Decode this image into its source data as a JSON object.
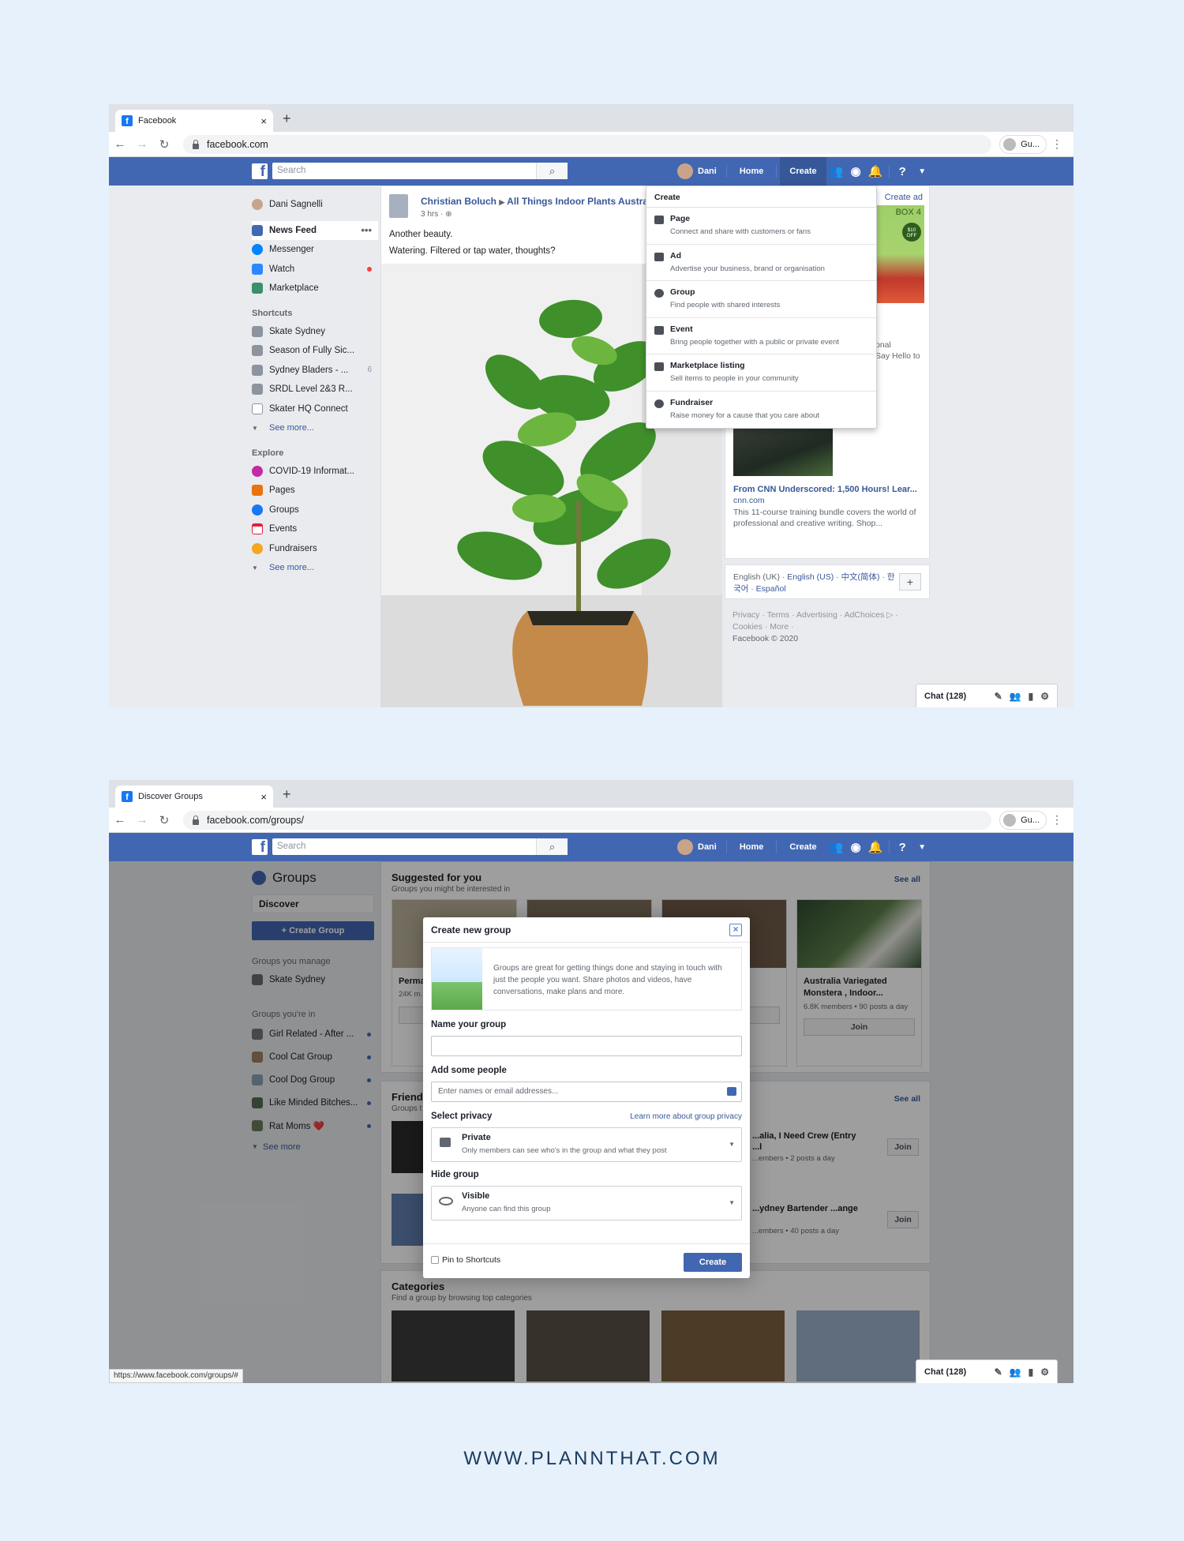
{
  "screen1": {
    "tab_title": "Facebook",
    "url": "facebook.com",
    "guest": "Gu...",
    "search_placeholder": "Search",
    "nav": {
      "user": "Dani",
      "home": "Home",
      "create": "Create"
    },
    "sidebar": {
      "user": "Dani Sagnelli",
      "main": [
        {
          "label": "News Feed",
          "color": "#4267b2"
        },
        {
          "label": "Messenger",
          "color": "#0084ff"
        },
        {
          "label": "Watch",
          "color": "#2d88ff"
        },
        {
          "label": "Marketplace",
          "color": "#3b8f6c"
        }
      ],
      "shortcuts_heading": "Shortcuts",
      "shortcuts": [
        "Skate Sydney",
        "Season of Fully Sic...",
        "Sydney Bladers - ...",
        "SRDL Level 2&3 R...",
        "Skater HQ Connect"
      ],
      "shortcut_count": "6",
      "see_more": "See more...",
      "explore_heading": "Explore",
      "explore": [
        {
          "label": "COVID-19 Informat...",
          "color": "#c32aa3"
        },
        {
          "label": "Pages",
          "color": "#e9710f"
        },
        {
          "label": "Groups",
          "color": "#1877f2"
        },
        {
          "label": "Events",
          "color": "#e41e3f"
        },
        {
          "label": "Fundraisers",
          "color": "#f5a623"
        }
      ]
    },
    "post": {
      "author": "Christian Boluch",
      "group": "All Things Indoor Plants Austra",
      "time": "3 hrs",
      "line1": "Another beauty.",
      "line2": "Watering. Filtered or tap water, thoughts?"
    },
    "create_menu": {
      "heading": "Create",
      "items": [
        {
          "title": "Page",
          "desc": "Connect and share with customers or fans"
        },
        {
          "title": "Ad",
          "desc": "Advertise your business, brand or organisation"
        },
        {
          "title": "Group",
          "desc": "Find people with shared interests"
        },
        {
          "title": "Event",
          "desc": "Bring people together with a public or private event"
        },
        {
          "title": "Marketplace listing",
          "desc": "Sell items to people in your community"
        },
        {
          "title": "Fundraiser",
          "desc": "Raise money for a cause that you care about"
        }
      ]
    },
    "right": {
      "create_ad": "Create ad",
      "box_badge": "BOX 4",
      "box_off": "$10 OFF",
      "frag1": "onal",
      "frag2": "Say Hello to",
      "ad2_title": "From CNN Underscored: 1,500 Hours! Lear...",
      "ad2_domain": "cnn.com",
      "ad2_desc": "This 11-course training bundle covers the world of professional and creative writing. Shop...",
      "lang_current": "English (UK)",
      "lang_links": [
        "English (US)",
        "中文(简体)",
        "한국어",
        "Español"
      ],
      "footer_line1": "Privacy · Terms · Advertising · AdChoices ▷ ·",
      "footer_line2": "Cookies · More ·",
      "copyright": "Facebook © 2020"
    },
    "chat": "Chat (128)"
  },
  "screen2": {
    "tab_title": "Discover Groups",
    "url": "facebook.com/groups/",
    "guest": "Gu...",
    "search_placeholder": "Search",
    "nav": {
      "user": "Dani",
      "home": "Home",
      "create": "Create"
    },
    "groups_title": "Groups",
    "discover": "Discover",
    "create_group": "+ Create Group",
    "manage_heading": "Groups you manage",
    "managed": [
      "Skate Sydney"
    ],
    "in_heading": "Groups you're in",
    "member_of": [
      "Girl Related - After ...",
      "Cool Cat Group",
      "Cool Dog Group",
      "Like Minded Bitches...",
      "Rat Moms ❤️"
    ],
    "see_more": "See more",
    "suggested": {
      "title": "Suggested for you",
      "subtitle": "Groups you might be interested in",
      "see_all": "See all",
      "cards": [
        {
          "name": "Perma... Begin...",
          "meta": "24K m... day"
        },
        {
          "name": "",
          "meta": ""
        },
        {
          "name": "...ning,",
          "meta": "...s a"
        },
        {
          "name": "Australia Variegated Monstera , Indoor...",
          "meta": "6.8K members • 90 posts a day"
        }
      ],
      "join": "Join"
    },
    "friends": {
      "title": "Friend",
      "subtitle": "Groups t",
      "see_all": "See all",
      "rows": [
        {
          "name": "...alia, I Need Crew (Entry ...l",
          "meta": "...embers • 2 posts a day"
        },
        {
          "name": "...ydney Bartender ...ange",
          "meta": "...embers • 40 posts a day"
        }
      ],
      "join": "Join"
    },
    "categories": {
      "title": "Categories",
      "subtitle": "Find a group by browsing top categories"
    },
    "modal": {
      "title": "Create new group",
      "intro": "Groups are great for getting things done and staying in touch with just the people you want. Share photos and videos, have conversations, make plans and more.",
      "name_label": "Name your group",
      "people_label": "Add some people",
      "people_placeholder": "Enter names or email addresses...",
      "privacy_label": "Select privacy",
      "privacy_link": "Learn more about group privacy",
      "privacy_value": "Private",
      "privacy_desc": "Only members can see who's in the group and what they post",
      "hide_label": "Hide group",
      "visible_value": "Visible",
      "visible_desc": "Anyone can find this group",
      "pin_label": "Pin to Shortcuts",
      "create_btn": "Create"
    },
    "status_url": "https://www.facebook.com/groups/#",
    "chat": "Chat (128)"
  },
  "footer": "WWW.PLANNTHAT.COM"
}
